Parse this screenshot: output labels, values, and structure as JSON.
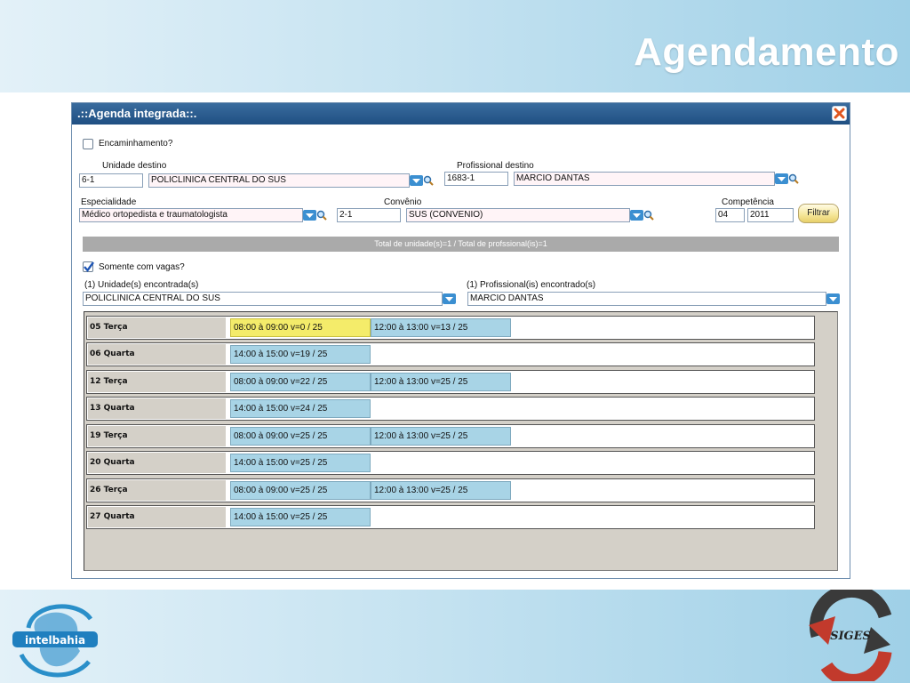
{
  "slide": {
    "title": "Agendamento"
  },
  "window": {
    "title": ".::Agenda integrada::.",
    "encaminhamento_label": "Encaminhamento?",
    "unidade_destino": {
      "label": "Unidade destino",
      "code": "6-1",
      "name": "POLICLINICA CENTRAL DO SUS"
    },
    "profissional_destino": {
      "label": "Profissional destino",
      "code": "1683-1",
      "name": "MARCIO DANTAS"
    },
    "especialidade": {
      "label": "Especialidade",
      "value": "Médico ortopedista e traumatologista"
    },
    "convenio": {
      "label": "Convênio",
      "code": "2-1",
      "name": "SUS (CONVENIO)"
    },
    "competencia": {
      "label": "Competência",
      "month": "04",
      "year": "2011"
    },
    "filtrar_label": "Filtrar",
    "totals_text": "Total de unidade(s)=1 / Total de profssional(is)=1",
    "somente_vagas_label": "Somente com vagas?",
    "unidades_encontradas": {
      "label": "(1) Unidade(s) encontrada(s)",
      "value": "POLICLINICA CENTRAL DO SUS"
    },
    "profissionais_encontrados": {
      "label": "(1) Profissional(is) encontrado(s)",
      "value": "MARCIO DANTAS"
    },
    "days": [
      {
        "label": "05 Terça",
        "slots": [
          "08:00 à 09:00 v=0 / 25",
          "12:00 à 13:00 v=13 / 25"
        ]
      },
      {
        "label": "06 Quarta",
        "slots": [
          "14:00 à 15:00 v=19 / 25"
        ]
      },
      {
        "label": "12 Terça",
        "slots": [
          "08:00 à 09:00 v=22 / 25",
          "12:00 à 13:00 v=25 / 25"
        ]
      },
      {
        "label": "13 Quarta",
        "slots": [
          "14:00 à 15:00 v=24 / 25"
        ]
      },
      {
        "label": "19 Terça",
        "slots": [
          "08:00 à 09:00 v=25 / 25",
          "12:00 à 13:00 v=25 / 25"
        ]
      },
      {
        "label": "20 Quarta",
        "slots": [
          "14:00 à 15:00 v=25 / 25"
        ]
      },
      {
        "label": "26 Terça",
        "slots": [
          "08:00 à 09:00 v=25 / 25",
          "12:00 à 13:00 v=25 / 25"
        ]
      },
      {
        "label": "27 Quarta",
        "slots": [
          "14:00 à 15:00 v=25 / 25"
        ]
      }
    ]
  },
  "logos": {
    "left_text": "intelbahia",
    "right_text": "SIGES"
  },
  "colors": {
    "title_bar": "#1f4f82",
    "slot_full": "#a8d4e6",
    "slot_empty": "#f4ec6a",
    "totals_bar": "#aaaaaa"
  },
  "icons": {
    "dropdown": "chevron-down-icon",
    "lookup": "magnifier-icon",
    "close": "close-icon"
  }
}
